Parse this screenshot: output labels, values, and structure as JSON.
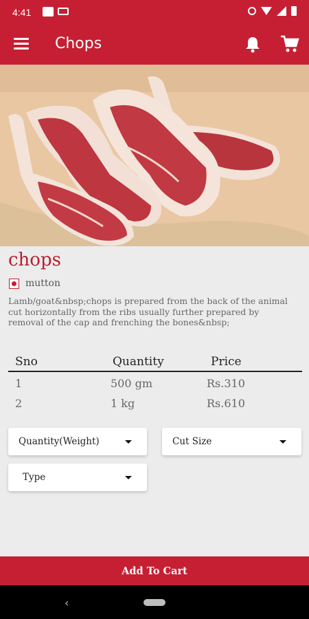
{
  "status_bar": {
    "time": "4:41"
  },
  "app_bar": {
    "title": "Chops"
  },
  "product": {
    "name": "chops",
    "category": "mutton",
    "description": "Lamb/goat&nbsp;chops is prepared from the back of the animal cut horizontally from the ribs usually further prepared by removal of the cap and frenching the bones&nbsp;"
  },
  "price_table": {
    "headers": [
      "Sno",
      "Quantity",
      "Price"
    ],
    "rows": [
      [
        "1",
        "500 gm",
        "Rs.310"
      ],
      [
        "2",
        "1 kg",
        "Rs.610"
      ]
    ]
  },
  "dropdowns": {
    "quantity": "Quantity(Weight)",
    "cut_size": "Cut Size",
    "type": "Type"
  },
  "actions": {
    "add_to_cart": "Add To Cart"
  },
  "colors": {
    "brand": "#c61f33",
    "background": "#ececec"
  },
  "icons": [
    "menu-icon",
    "bell-icon",
    "cart-icon",
    "alarm-icon",
    "wifi-icon",
    "signal-icon",
    "battery-icon",
    "back-icon"
  ]
}
